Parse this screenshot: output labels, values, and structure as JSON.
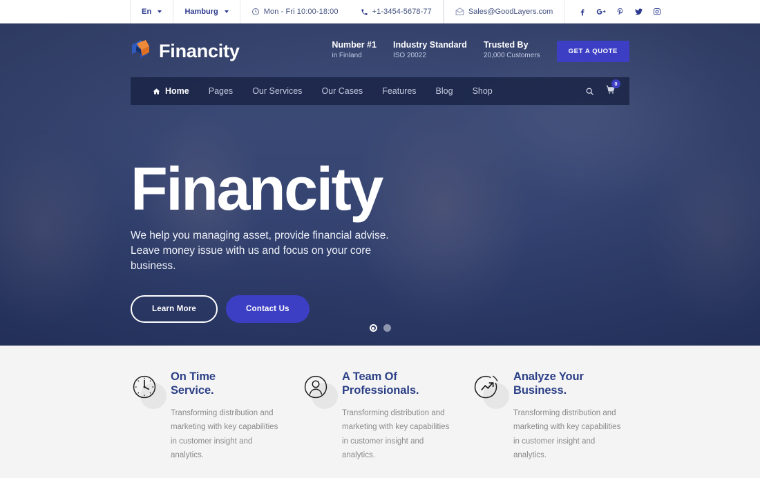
{
  "topbar": {
    "language": "En",
    "city": "Hamburg",
    "hours": "Mon - Fri 10:00-18:00",
    "phone": "+1-3454-5678-77",
    "email": "Sales@GoodLayers.com",
    "icons": {
      "clock": "clock-icon",
      "phone": "phone-icon",
      "email": "envelope-icon"
    },
    "social": [
      {
        "name": "facebook-icon",
        "label": "f"
      },
      {
        "name": "google-plus-icon",
        "label": "G+"
      },
      {
        "name": "pinterest-icon",
        "label": "P"
      },
      {
        "name": "twitter-icon",
        "label": "t"
      },
      {
        "name": "instagram-icon",
        "label": "ig"
      }
    ]
  },
  "header": {
    "logo_text": "Financity",
    "stats": [
      {
        "title": "Number #1",
        "sub": "in Finland"
      },
      {
        "title": "Industry Standard",
        "sub": "ISO 20022"
      },
      {
        "title": "Trusted By",
        "sub": "20,000 Customers"
      }
    ],
    "quote_button": "GET A QUOTE"
  },
  "nav": {
    "items": [
      {
        "label": "Home",
        "active": true,
        "icon": "home-icon"
      },
      {
        "label": "Pages",
        "active": false
      },
      {
        "label": "Our Services",
        "active": false
      },
      {
        "label": "Our Cases",
        "active": false
      },
      {
        "label": "Features",
        "active": false
      },
      {
        "label": "Blog",
        "active": false
      },
      {
        "label": "Shop",
        "active": false
      }
    ],
    "search_icon": "search-icon",
    "cart_icon": "cart-icon",
    "cart_count": "0"
  },
  "hero": {
    "title": "Financity",
    "subtitle": "We help you managing asset, provide financial advise. Leave money issue with us and focus on your core business.",
    "primary_button": "Contact Us",
    "secondary_button": "Learn More",
    "slides": [
      {
        "active": true
      },
      {
        "active": false
      }
    ]
  },
  "features": [
    {
      "icon": "clock-icon",
      "title_line1": "On Time",
      "title_line2": "Service.",
      "description": "Transforming distribution and marketing with key capabilities in customer insight and analytics."
    },
    {
      "icon": "user-icon",
      "title_line1": "A Team Of",
      "title_line2": "Professionals.",
      "description": "Transforming distribution and marketing with key capabilities in customer insight and analytics."
    },
    {
      "icon": "trending-up-icon",
      "title_line1": "Analyze Your",
      "title_line2": "Business.",
      "description": "Transforming distribution and marketing with key capabilities in customer insight and analytics."
    }
  ],
  "colors": {
    "accent": "#3c3fc4",
    "navy": "#2b3f86",
    "header_bg": "#20356e",
    "features_bg": "#f4f4f4"
  }
}
